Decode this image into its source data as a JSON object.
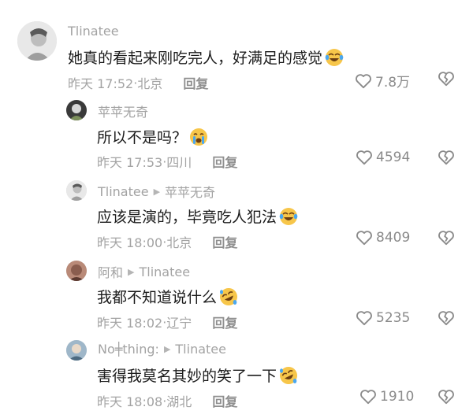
{
  "comments": [
    {
      "user": "Tlinatee",
      "reply_to": "",
      "text": "她真的看起来刚吃完人，好满足的感觉",
      "emoji": "laughing-tears-emoji",
      "time": "昨天 17:52",
      "location": "北京",
      "reply_label": "回复",
      "likes": "7.8万"
    },
    {
      "user": "苹苹无奇",
      "reply_to": "",
      "text": "所以不是吗？",
      "emoji": "crying-face-emoji",
      "time": "昨天 17:53",
      "location": "四川",
      "reply_label": "回复",
      "likes": "4594"
    },
    {
      "user": "Tlinatee",
      "reply_to": "苹苹无奇",
      "text": "应该是演的，毕竟吃人犯法",
      "emoji": "laughing-tears-emoji",
      "time": "昨天 18:00",
      "location": "北京",
      "reply_label": "回复",
      "likes": "8409"
    },
    {
      "user": "阿和",
      "reply_to": "Tlinatee",
      "text": "我都不知道说什么",
      "emoji": "rofl-emoji",
      "time": "昨天 18:02",
      "location": "辽宁",
      "reply_label": "回复",
      "likes": "5235"
    },
    {
      "user": "No╪thing:",
      "reply_to": "Tlinatee",
      "text": "害得我莫名其妙的笑了一下",
      "emoji": "rofl-emoji",
      "time": "昨天 18:08",
      "location": "湖北",
      "reply_label": "回复",
      "likes": "1910"
    }
  ],
  "separator": "·",
  "arrow_glyph": "▶",
  "colors": {
    "meta": "#a3a3a3",
    "text": "#1c1c1c",
    "emoji_face": "#f7c64a"
  }
}
